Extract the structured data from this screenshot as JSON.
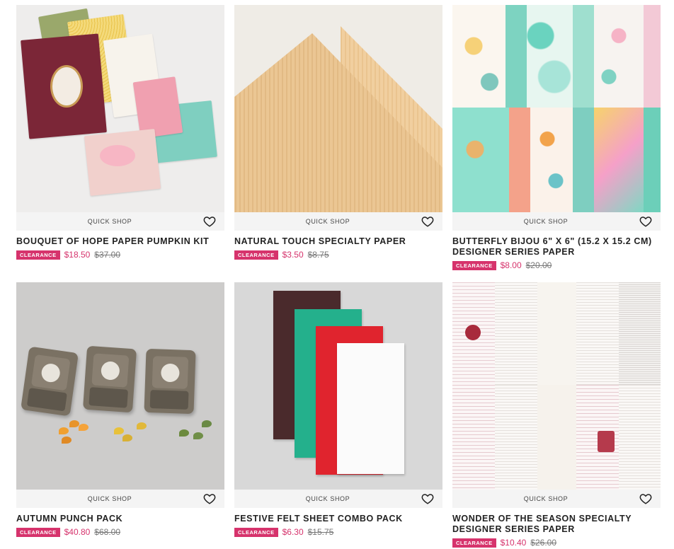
{
  "quick_shop_label": "QUICK SHOP",
  "clearance_label": "CLEARANCE",
  "colors": {
    "accent": "#d6336c",
    "bar": "#f4f4f4"
  },
  "products": [
    {
      "title": "BOUQUET OF HOPE PAPER PUMPKIN KIT",
      "price": "$18.50",
      "original": "$37.00",
      "image": "card-kit-image"
    },
    {
      "title": "NATURAL TOUCH SPECIALTY PAPER",
      "price": "$3.50",
      "original": "$8.75",
      "image": "wood-paper-image"
    },
    {
      "title": "BUTTERFLY BIJOU 6\" X 6\" (15.2 X 15.2 CM) DESIGNER SERIES PAPER",
      "price": "$8.00",
      "original": "$20.00",
      "image": "butterfly-paper-image"
    },
    {
      "title": "AUTUMN PUNCH PACK",
      "price": "$40.80",
      "original": "$68.00",
      "image": "punch-pack-image"
    },
    {
      "title": "FESTIVE FELT SHEET COMBO PACK",
      "price": "$6.30",
      "original": "$15.75",
      "image": "felt-sheets-image"
    },
    {
      "title": "WONDER OF THE SEASON SPECIALTY DESIGNER SERIES PAPER",
      "price": "$10.40",
      "original": "$26.00",
      "image": "text-paper-image"
    }
  ]
}
